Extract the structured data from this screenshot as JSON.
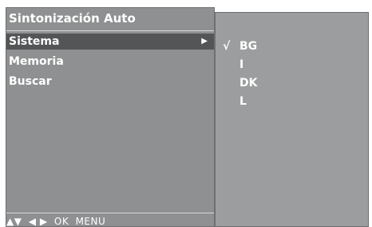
{
  "menu": {
    "title": "Sintonización Auto",
    "items": [
      {
        "label": "Sistema",
        "arrow": "▶",
        "selected": true
      },
      {
        "label": "Memoria"
      },
      {
        "label": "Buscar"
      }
    ],
    "footer": {
      "nav_arrows": "▲▼",
      "lr_arrows": "◀ ▶",
      "ok": "OK",
      "menu": "MENU"
    }
  },
  "submenu": {
    "check_mark": "√",
    "options": [
      {
        "label": "BG",
        "checked": true
      },
      {
        "label": "I"
      },
      {
        "label": "DK"
      },
      {
        "label": "L"
      }
    ]
  },
  "colors": {
    "panel": "#8f9091",
    "selected": "#545556",
    "submenu": "#9c9d9e",
    "text": "#ffffff"
  }
}
